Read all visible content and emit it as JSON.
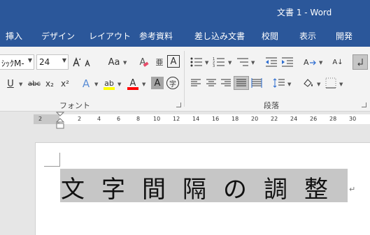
{
  "window": {
    "title": "文書 1  -  Word"
  },
  "tabs": [
    {
      "label": "挿入"
    },
    {
      "label": "デザイン"
    },
    {
      "label": "レイアウト"
    },
    {
      "label": "参考資料"
    },
    {
      "label": "差し込み文書"
    },
    {
      "label": "校閲"
    },
    {
      "label": "表示"
    },
    {
      "label": "開発"
    }
  ],
  "font_group": {
    "font_name": "ｼｯｸM-",
    "font_size": "24",
    "label": "フォント",
    "grow_font_glyph": "Aa",
    "clear_format_glyph": "A",
    "furigana_glyph": "亜",
    "char_border_glyph": "A",
    "underline_glyph": "U",
    "strike_glyph": "abc",
    "subscript_glyph": "x₂",
    "superscript_glyph": "x²",
    "text_effect_glyph": "A",
    "highlight_glyph": "ab",
    "font_color_glyph": "A",
    "char_shading_glyph": "A",
    "enclose_glyph": "字"
  },
  "paragraph_group": {
    "label": "段落",
    "sort_glyph": "A↓"
  },
  "ruler": {
    "ticks": [
      "2",
      "2",
      "4",
      "6",
      "8",
      "10",
      "12",
      "14",
      "16",
      "18",
      "20",
      "22",
      "24",
      "26",
      "28",
      "30"
    ]
  },
  "document": {
    "text": "文字間隔の調整",
    "para_mark": "↵"
  },
  "colors": {
    "accent": "#2b579a",
    "highlight": "#ffff00",
    "font_color": "#ff0000"
  }
}
